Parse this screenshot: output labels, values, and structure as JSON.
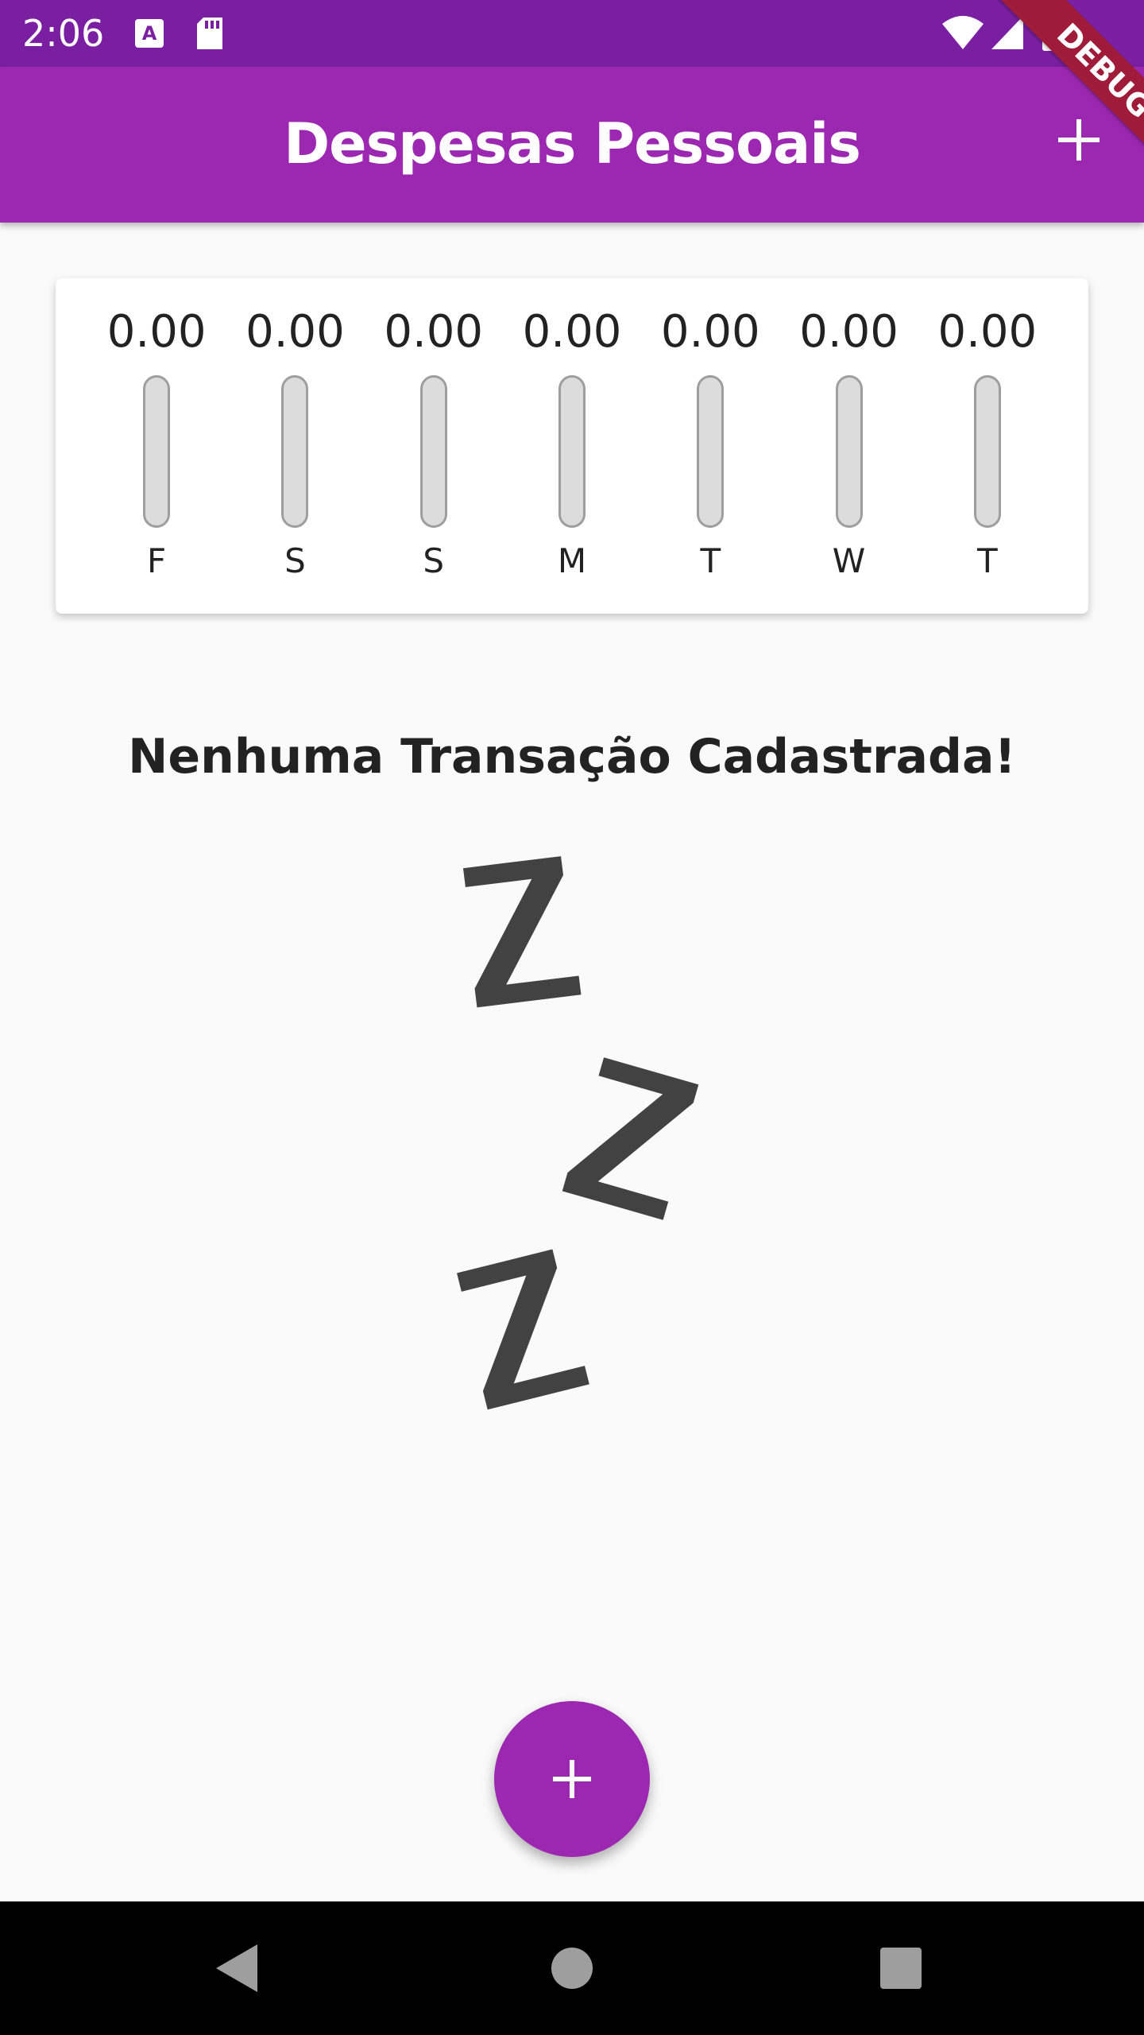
{
  "status_bar": {
    "time": "2:06",
    "icons": [
      "text-a-icon",
      "sd-card-icon",
      "wifi-icon",
      "signal-icon",
      "battery-icon"
    ]
  },
  "debug_banner": {
    "label": "DEBUG"
  },
  "app_bar": {
    "title": "Despesas Pessoais",
    "action_icon": "plus-icon"
  },
  "chart": {
    "accent_color": "#9c27b0",
    "bars": [
      {
        "day": "F",
        "value": "0.00",
        "fill": 0
      },
      {
        "day": "S",
        "value": "0.00",
        "fill": 0
      },
      {
        "day": "S",
        "value": "0.00",
        "fill": 0
      },
      {
        "day": "M",
        "value": "0.00",
        "fill": 0
      },
      {
        "day": "T",
        "value": "0.00",
        "fill": 0
      },
      {
        "day": "W",
        "value": "0.00",
        "fill": 0
      },
      {
        "day": "T",
        "value": "0.00",
        "fill": 0
      }
    ]
  },
  "empty_state": {
    "message": "Nenhuma Transação Cadastrada!",
    "image_icon": "zzz-sleep-icon"
  },
  "fab": {
    "icon": "plus-icon"
  },
  "nav_bar": {
    "icons": [
      "back-triangle-icon",
      "home-circle-icon",
      "recents-square-icon"
    ]
  },
  "colors": {
    "primary": "#9c27b0",
    "primary_dark": "#7b1fa2",
    "background": "#fafafa"
  }
}
